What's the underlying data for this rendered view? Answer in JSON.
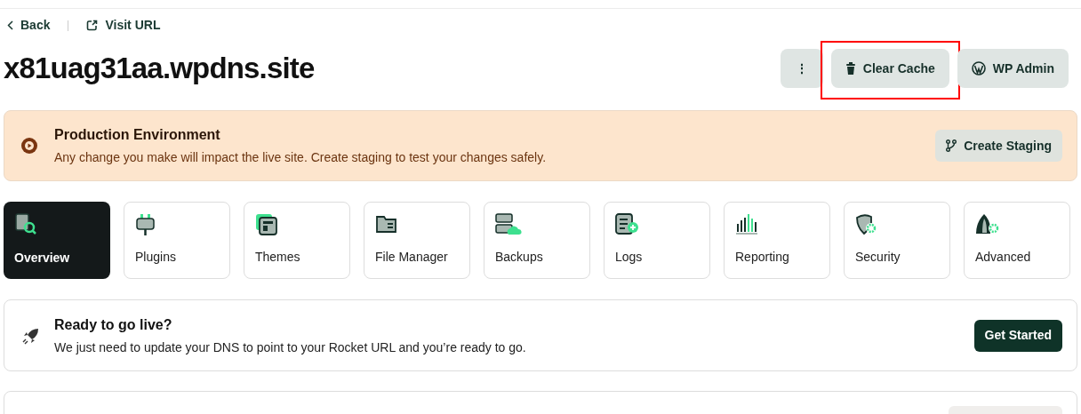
{
  "nav": {
    "back": "Back",
    "visit": "Visit URL"
  },
  "title": "x81uag31aa.wpdns.site",
  "actions": [
    {
      "kind": "menu",
      "label": "⋮",
      "highlighted": false
    },
    {
      "kind": "cache",
      "label": "Clear Cache",
      "highlighted": true
    },
    {
      "kind": "wp",
      "label": "WP Admin",
      "highlighted": false
    }
  ],
  "banner": {
    "title": "Production Environment",
    "text": "Any change you make will impact the live site. Create staging to test your changes safely.",
    "button": "Create Staging"
  },
  "tabs": [
    {
      "label": "Overview",
      "selected": true
    },
    {
      "label": "Plugins",
      "selected": false
    },
    {
      "label": "Themes",
      "selected": false
    },
    {
      "label": "File Manager",
      "selected": false
    },
    {
      "label": "Backups",
      "selected": false
    },
    {
      "label": "Logs",
      "selected": false
    },
    {
      "label": "Reporting",
      "selected": false
    },
    {
      "label": "Security",
      "selected": false
    },
    {
      "label": "Advanced",
      "selected": false
    }
  ],
  "golive": {
    "title": "Ready to go live?",
    "text": "We just need to update your DNS to point to your Rocket URL and you’re ready to go.",
    "button": "Get Started"
  }
}
